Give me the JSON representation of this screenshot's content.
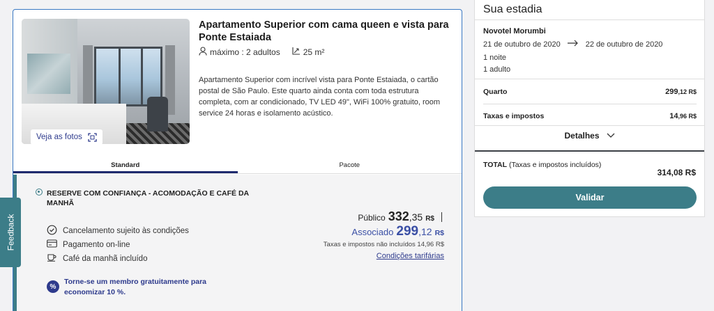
{
  "room": {
    "title": "Apartamento Superior com cama queen e vista para Ponte Estaiada",
    "capacity": "máximo : 2 adultos",
    "area": "25 m²",
    "description": "Apartamento Superior com incrível vista para Ponte Estaiada, o cartão postal de São Paulo. Este quarto ainda conta com toda estrutura completa, com ar condicionado, TV LED 49\", WiFi 100% gratuito, room service 24 horas e isolamento acústico.",
    "photos_label": "Veja as fotos"
  },
  "tabs": [
    {
      "label": "Standard",
      "active": true
    },
    {
      "label": "Pacote",
      "active": false
    }
  ],
  "offer": {
    "title": "RESERVE COM CONFIANÇA - ACOMODAÇÃO E CAFÉ DA MANHÃ",
    "features": [
      {
        "icon": "clock-check-icon",
        "label": "Cancelamento sujeito às condições"
      },
      {
        "icon": "credit-card-icon",
        "label": "Pagamento on-line"
      },
      {
        "icon": "coffee-cup-icon",
        "label": "Café da manhã incluído"
      }
    ],
    "member_badge": "%",
    "member_text": "Torne-se um membro gratuitamente para economizar 10 %.",
    "public_label": "Público",
    "public_int": "332",
    "public_dec": ",35",
    "member_label": "Associado",
    "member_int": "299",
    "member_dec": ",12",
    "currency": "R$",
    "taxes_note": "Taxas e impostos não incluídos 14,96 R$",
    "conditions_link": "Condições tarifárias"
  },
  "feedback_label": "Feedback",
  "summary": {
    "heading": "Sua estadia",
    "hotel": "Novotel Morumbi",
    "checkin": "21 de outubro de 2020",
    "checkout": "22 de outubro de 2020",
    "nights": "1 noite",
    "adults": "1 adulto",
    "room_label": "Quarto",
    "room_int": "299",
    "room_dec": ",12 R$",
    "taxes_label": "Taxas e impostos",
    "taxes_int": "14",
    "taxes_dec": ",96 R$",
    "details_label": "Detalhes",
    "total_label": "TOTAL",
    "total_sub": "(Taxas e impostos incluídos)",
    "total_value": "314,08 R$",
    "validate_label": "Validar"
  },
  "colors": {
    "teal": "#3c7d88",
    "navy": "#2d3a8c",
    "associate": "#3a4fa5",
    "card_border": "#3a78c2"
  }
}
